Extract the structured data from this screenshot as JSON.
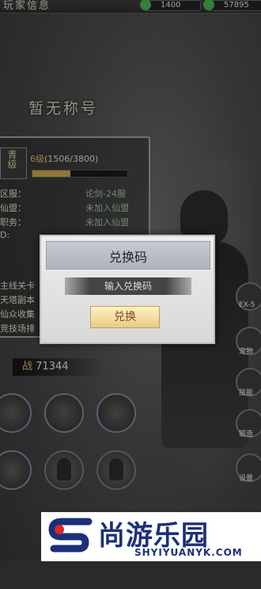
{
  "top": {
    "title": "玩家信息",
    "res1": "1400",
    "res2": "57895"
  },
  "profile": {
    "honor_title": "暂无称号",
    "rank_badge": "青级",
    "level_label": "6级",
    "xp_text": "(1506/3800)",
    "xp_progress": 0.396,
    "fields": [
      {
        "label": "区服：",
        "value": "论剑-24服"
      },
      {
        "label": "仙盟：",
        "value": "未加入仙盟"
      },
      {
        "label": "职务：",
        "value": "未加入仙盟"
      },
      {
        "label": "D:",
        "value": ""
      }
    ],
    "quests": [
      "主线关卡",
      "天塔副本",
      "仙众收集",
      "竞技场排"
    ],
    "power_label": "战",
    "power_value": "71344"
  },
  "side_buttons": [
    "EX-5",
    "宠物",
    "技能",
    "锻造",
    "设置"
  ],
  "dialog": {
    "title": "兑换码",
    "input_placeholder": "输入兑换码",
    "button_label": "兑换"
  },
  "watermark": {
    "brand": "尚游乐园",
    "url": "SHYIYUANYK.COM"
  },
  "colors": {
    "accent": "#c9a24a",
    "dialog_bg": "#e2e2e2",
    "button_bg": "#f5dfa0",
    "brand_blue": "#1c2f7a",
    "brand_red": "#d8262a"
  }
}
